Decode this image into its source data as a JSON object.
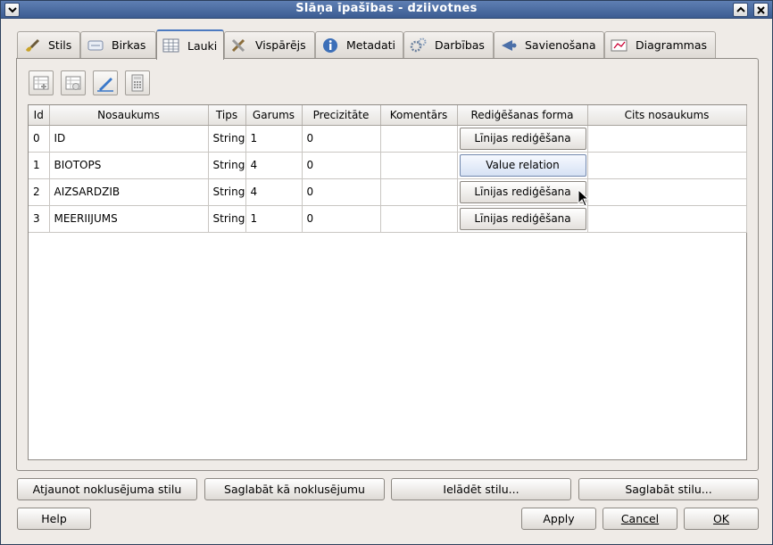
{
  "window": {
    "title": "Slāņa īpašības - dziivotnes"
  },
  "tabs": [
    {
      "label": "Stils",
      "icon": "brush-icon"
    },
    {
      "label": "Birkas",
      "icon": "label-icon"
    },
    {
      "label": "Lauki",
      "icon": "table-icon",
      "active": true
    },
    {
      "label": "Vispārējs",
      "icon": "tools-icon"
    },
    {
      "label": "Metadati",
      "icon": "info-icon"
    },
    {
      "label": "Darbības",
      "icon": "gears-icon"
    },
    {
      "label": "Savienošana",
      "icon": "join-icon"
    },
    {
      "label": "Diagrammas",
      "icon": "diagram-icon"
    }
  ],
  "toolbar": [
    "new-column-icon",
    "delete-column-icon",
    "edit-pencil-icon",
    "calculator-icon"
  ],
  "table": {
    "headers": [
      "Id",
      "Nosaukums",
      "Tips",
      "Garums",
      "Precizitāte",
      "Komentārs",
      "Rediģēšanas forma",
      "Cits nosaukums"
    ],
    "rows": [
      {
        "id": "0",
        "name": "ID",
        "type": "String",
        "length": "1",
        "precision": "0",
        "comment": "",
        "edit": "Līnijas rediģēšana",
        "alias": ""
      },
      {
        "id": "1",
        "name": "BIOTOPS",
        "type": "String",
        "length": "4",
        "precision": "0",
        "comment": "",
        "edit": "Value relation",
        "alias": ""
      },
      {
        "id": "2",
        "name": "AIZSARDZIB",
        "type": "String",
        "length": "4",
        "precision": "0",
        "comment": "",
        "edit": "Līnijas rediģēšana",
        "alias": ""
      },
      {
        "id": "3",
        "name": "MEERIIJUMS",
        "type": "String",
        "length": "1",
        "precision": "0",
        "comment": "",
        "edit": "Līnijas rediģēšana",
        "alias": ""
      }
    ]
  },
  "buttons": {
    "restore_default": "Atjaunot noklusējuma stilu",
    "save_default": "Saglabāt kā noklusējumu",
    "load_style": "Ielādēt stilu...",
    "save_style": "Saglabāt stilu...",
    "help": "Help",
    "apply": "Apply",
    "cancel": "Cancel",
    "ok": "OK"
  }
}
